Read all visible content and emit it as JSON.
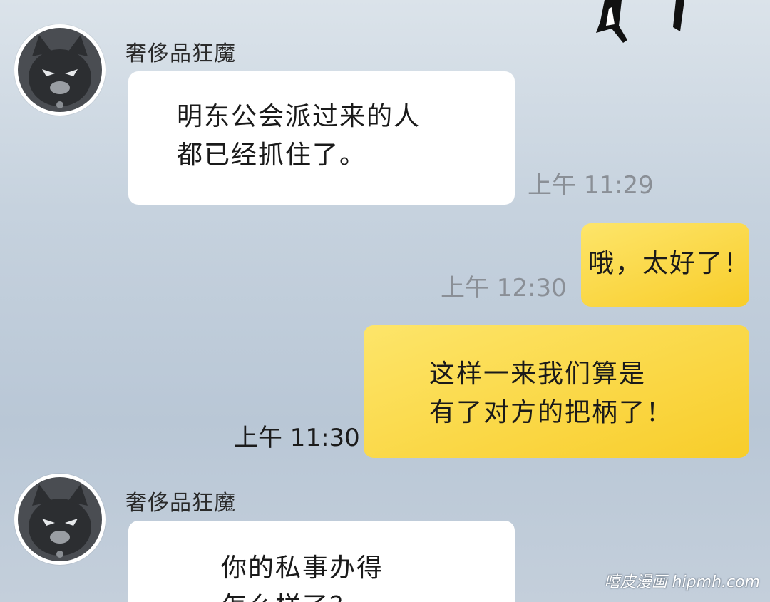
{
  "messages": [
    {
      "sender": "奢侈品狂魔",
      "lines": [
        "明东公会派过来的人",
        "都已经抓住了。"
      ],
      "time": "上午 11:29"
    },
    {
      "lines": [
        "哦，太好了！"
      ],
      "time": "上午 12:30"
    },
    {
      "lines": [
        "这样一来我们算是",
        "有了对方的把柄了！"
      ],
      "time": "上午 11:30"
    },
    {
      "sender": "奢侈品狂魔",
      "lines": [
        "你的私事办得",
        "怎么样了？"
      ]
    }
  ],
  "watermark": "嘻皮漫画 hipmh.com",
  "colors": {
    "incoming_bubble": "#ffffff",
    "outgoing_bubble": "#f9d230",
    "timestamp_muted": "#8a8f96",
    "timestamp_dark": "#1b1b1b"
  },
  "icons": [
    "cat-avatar-icon",
    "ink-stroke-decoration"
  ]
}
